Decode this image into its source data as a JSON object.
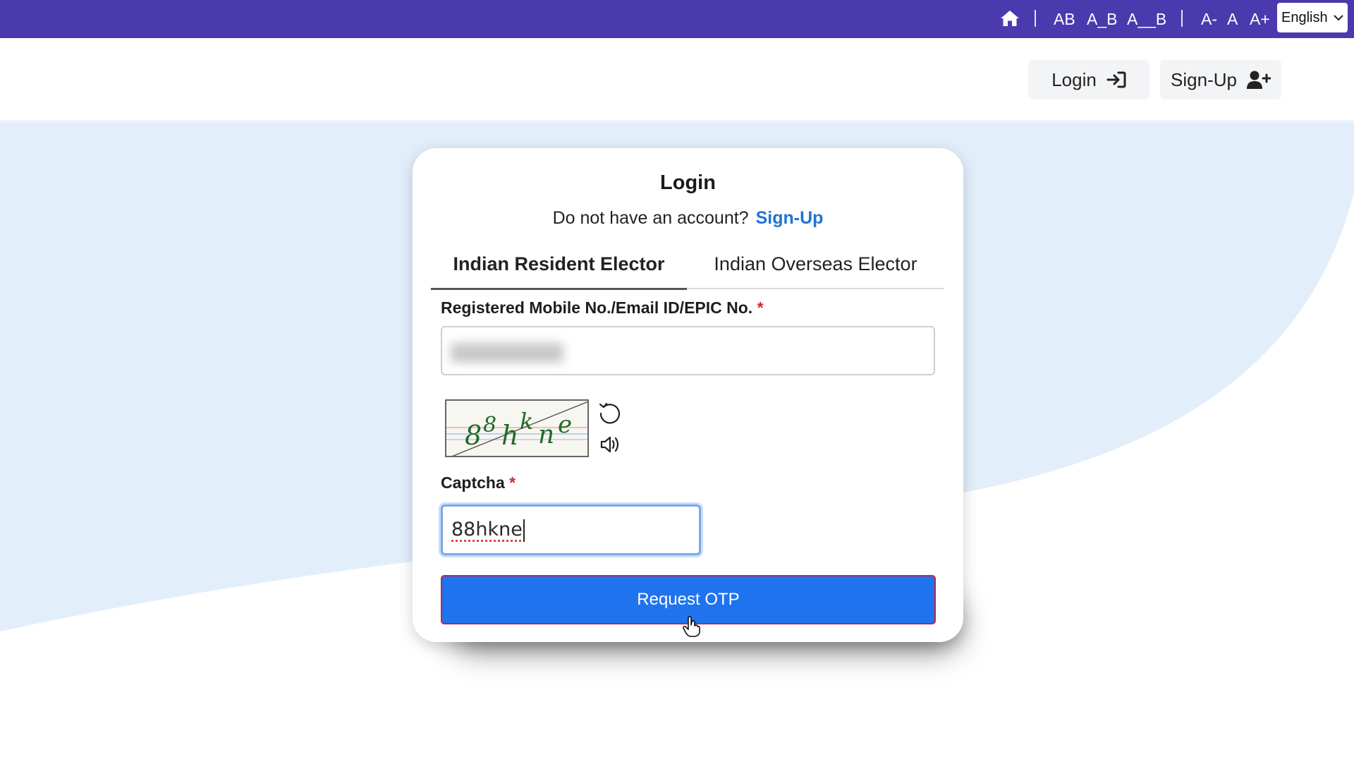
{
  "topbar": {
    "home_icon": "home-icon",
    "spacing_normal": "AB",
    "spacing_medium": "A_B",
    "spacing_large": "A__B",
    "font_decrease": "A-",
    "font_normal": "A",
    "font_increase": "A+",
    "language": "English",
    "bg_color": "#4a3aae"
  },
  "header": {
    "login_label": "Login",
    "signup_label": "Sign-Up"
  },
  "card": {
    "title": "Login",
    "no_account_text": "Do not have an account?",
    "signup_link": "Sign-Up",
    "tabs": [
      {
        "label": "Indian Resident Elector",
        "active": true
      },
      {
        "label": "Indian Overseas Elector",
        "active": false
      }
    ],
    "mobile_label": "Registered Mobile No./Email ID/EPIC No.",
    "required_mark": "*",
    "captcha_text": "88hkne",
    "captcha_label": "Captcha",
    "captcha_value": "88hkne",
    "request_otp_label": "Request OTP",
    "accent_color": "#1f73ef",
    "link_color": "#1f74d4"
  }
}
